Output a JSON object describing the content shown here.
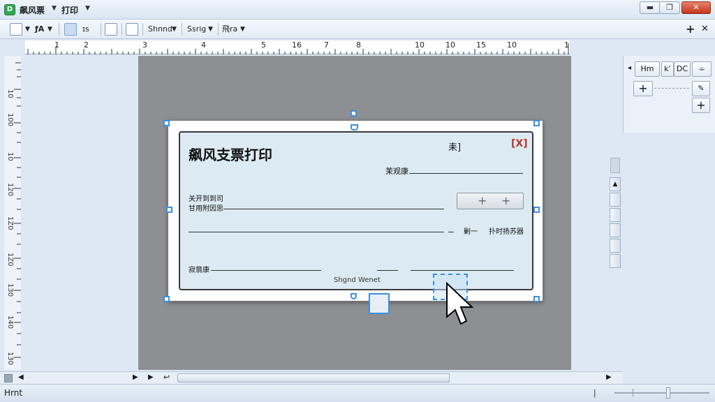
{
  "titlebar": {
    "app_name": "飙风票",
    "menu_label": "打印",
    "minimize": "▬",
    "restore": "❐",
    "close": "✕"
  },
  "toolbar": {
    "new_icon": "new-document-icon",
    "font_label": "Shnnd",
    "size_label": "Ssrig",
    "style_label": "飛ra",
    "pin": "+",
    "close": "✕",
    "as_label": "ɪs"
  },
  "ruler": {
    "numbers": [
      "1",
      "2",
      "3",
      "4",
      "5",
      "16",
      "7",
      "8",
      "10",
      "10",
      "15",
      "10",
      "1"
    ]
  },
  "vruler": {
    "numbers": [
      "10",
      "100",
      "10",
      "120",
      "1Z0",
      "1Z0",
      "130",
      "140",
      "130"
    ]
  },
  "check": {
    "title": "飙风支票打印",
    "top_right_label": "耒]",
    "top_right_mark": "[X]",
    "date_label": "茉观康",
    "payee_label_1": "关开到到司",
    "payee_label_2": "甘用附因思",
    "amount_words_label": "剿一",
    "amount_words_suffix": "扑时扬苏器",
    "memo_label": "寂翡康",
    "signature_caption": "Shgnd Wenet",
    "field_plus_1": "+",
    "field_plus_2": "+"
  },
  "rpanel": {
    "nav_arrow": "◂",
    "tab_1": "Hm",
    "tab_2": "kʼ",
    "tab_3": "DC",
    "tab_4": "⌯",
    "add_1": "+",
    "add_2": "+",
    "pen_icon": "pen-icon"
  },
  "statusbar": {
    "status_text": "Hrnt",
    "page_indicator": "ǀ"
  },
  "hscroll": {
    "left": "◀",
    "right": "▶",
    "next": "▶",
    "back": "↩"
  },
  "vscroll": {
    "up": "▲"
  }
}
